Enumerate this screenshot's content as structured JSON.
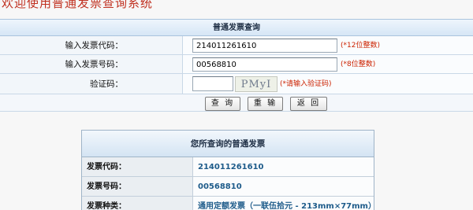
{
  "site": {
    "title": "欢迎使用普通发票查询系统"
  },
  "query_form": {
    "header": "普通发票查询",
    "invoice_code": {
      "label": "输入发票代码：",
      "value": "214011261610",
      "hint": "(*12位整数)"
    },
    "invoice_number": {
      "label": "输入发票号码：",
      "value": "00568810",
      "hint": "(*8位整数)"
    },
    "captcha": {
      "label": "验证码：",
      "value": "",
      "image_text": "PMyI",
      "hint": "(*请输入验证码)"
    },
    "buttons": {
      "query": "查 询",
      "reset": "重 输",
      "back": "返 回"
    }
  },
  "result": {
    "header": "您所查询的普通发票",
    "rows": [
      {
        "label": "发票代码：",
        "value": "214011261610"
      },
      {
        "label": "发票号码：",
        "value": "00568810"
      },
      {
        "label": "发票种类：",
        "value": "通用定额发票（一联伍拾元 - 213mm×77mm）"
      }
    ]
  },
  "colors": {
    "title": "#c03020",
    "hint": "#cc2200",
    "result_value": "#1d5b8a",
    "border": "#aac4de"
  }
}
